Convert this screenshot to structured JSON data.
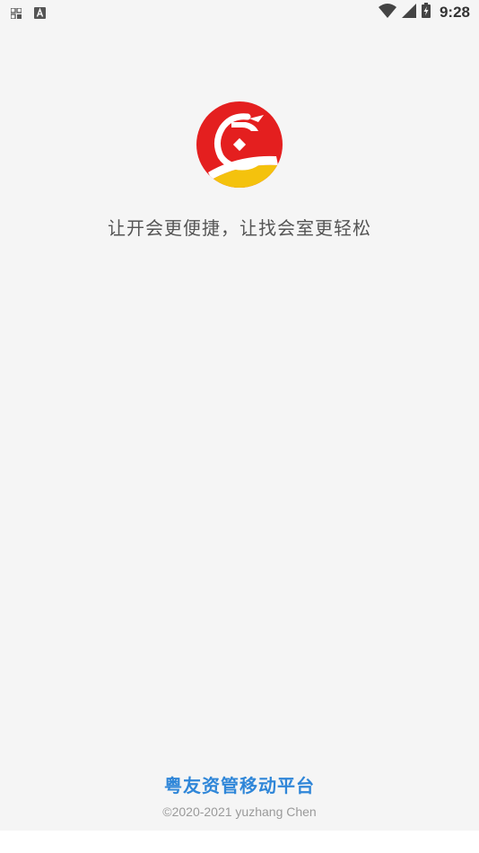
{
  "status_bar": {
    "time": "9:28",
    "left_icons": [
      "grid-notification-icon",
      "a-notification-icon"
    ],
    "right_icons": [
      "wifi-icon",
      "cellular-signal-icon",
      "battery-charging-icon"
    ]
  },
  "splash": {
    "tagline": "让开会更便捷，让找会室更轻松",
    "logo_icon": "dragon-logo-icon"
  },
  "footer": {
    "app_name": "粤友资管移动平台",
    "copyright": "©2020-2021 yuzhang Chen"
  },
  "colors": {
    "background": "#f5f5f5",
    "brand_blue": "#2f86d8",
    "logo_red": "#e41f1f",
    "logo_yellow": "#f4c20d"
  }
}
